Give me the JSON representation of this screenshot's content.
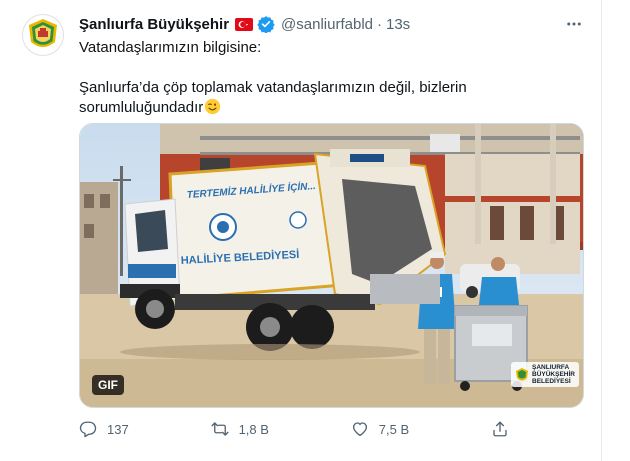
{
  "tweet": {
    "display_name": "Şanlıurfa Büyükşehir",
    "handle": "@sanliurfabld",
    "separator": "·",
    "time": "13s",
    "line1": "Vatandaşlarımızın bilgisine:",
    "line2": "Şanlıurfa’da çöp toplamak vatandaşlarımızın değil, bizlerin",
    "line3": "sorumluluğundadır",
    "emoji_icon": "winking-face-emoji"
  },
  "media": {
    "gif_label": "GIF",
    "truck_text_1": "TERTEMİZ HALİLİYE İÇİN...",
    "truck_text_2": "HALİLİYE BELEDİYESİ",
    "watermark_line1": "ŞANLIURFA",
    "watermark_line2": "BÜYÜKŞEHİR",
    "watermark_line3": "BELEDİYESİ"
  },
  "actions": {
    "reply_count": "137",
    "retweet_count": "1,8 B",
    "like_count": "7,5 B"
  },
  "colors": {
    "accent": "#1d9bf0",
    "muted": "#536471",
    "truck_blue": "#2a6fb0"
  }
}
